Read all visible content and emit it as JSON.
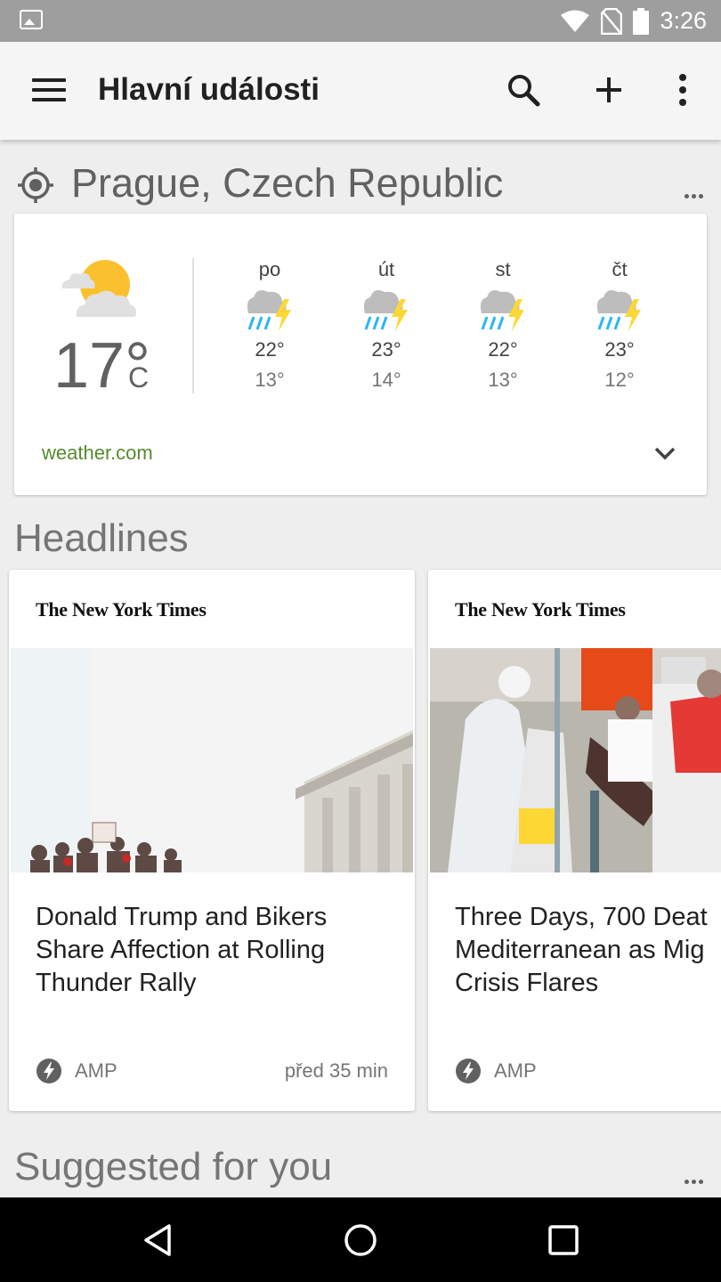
{
  "status_bar": {
    "time": "3:26"
  },
  "app_bar": {
    "title": "Hlavní události",
    "actions": [
      "search-icon",
      "add-icon",
      "more-vert-icon"
    ]
  },
  "weather": {
    "location": "Prague, Czech Republic",
    "current": {
      "icon": "partly-cloudy-sun-icon",
      "temp": "17°",
      "unit": "C"
    },
    "forecast": [
      {
        "day": "po",
        "icon": "rain-thunder-icon",
        "high": "22°",
        "low": "13°"
      },
      {
        "day": "út",
        "icon": "rain-thunder-icon",
        "high": "23°",
        "low": "14°"
      },
      {
        "day": "st",
        "icon": "rain-thunder-icon",
        "high": "22°",
        "low": "13°"
      },
      {
        "day": "čt",
        "icon": "rain-thunder-icon",
        "high": "23°",
        "low": "12°"
      }
    ],
    "source": "weather.com"
  },
  "headlines": {
    "title": "Headlines",
    "cards": [
      {
        "publisher": "The New York Times",
        "title_lines": [
          "Donald Trump and Bikers",
          "Share Affection at Rolling",
          "Thunder Rally"
        ],
        "badge": "AMP",
        "time": "před 35 min"
      },
      {
        "publisher": "The New York Times",
        "title_lines": [
          "Three Days, 700 Deat",
          "Mediterranean as Mig",
          "Crisis Flares"
        ],
        "badge": "AMP",
        "time": ""
      }
    ]
  },
  "suggested": {
    "title": "Suggested for you"
  },
  "colors": {
    "accent_green": "#558b2f",
    "sun": "#fbc02d",
    "rain": "#29b6f6",
    "bolt": "#fdd835"
  }
}
